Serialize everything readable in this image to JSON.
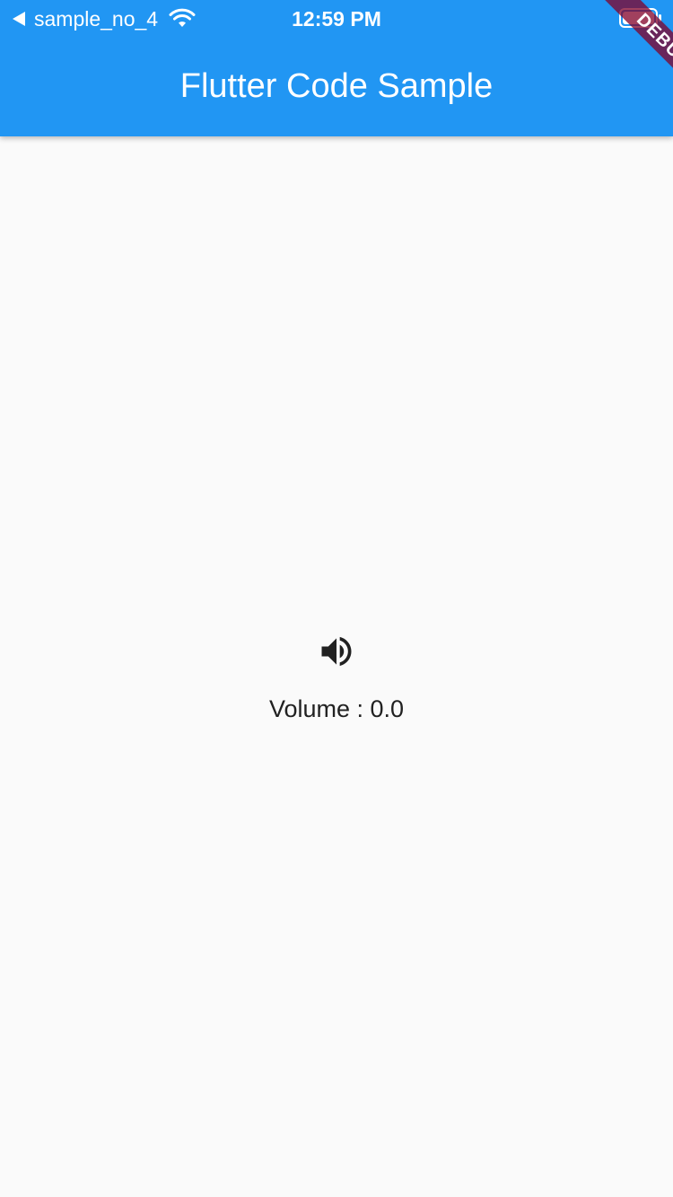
{
  "status_bar": {
    "back_app_label": "sample_no_4",
    "time": "12:59 PM",
    "icons": [
      "back-arrow-icon",
      "wifi-icon",
      "battery-icon"
    ]
  },
  "appbar": {
    "title": "Flutter Code Sample",
    "color": "#2196f3"
  },
  "debug_banner": {
    "label": "DEBUG"
  },
  "main": {
    "icon": "volume-up-icon",
    "volume_text": "Volume : 0.0"
  }
}
